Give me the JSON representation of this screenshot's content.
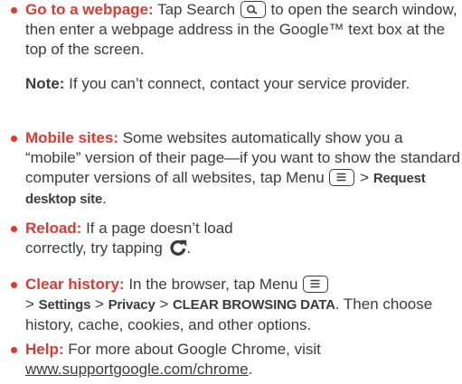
{
  "items": [
    {
      "title": "Go to a webpage:",
      "text_a": " Tap Search ",
      "text_b": " to open the search window, then enter a webpage address in the Google™ text box at the top of the screen."
    },
    {
      "note_label": "Note:",
      "note_text": " If you can’t connect, contact your service provider."
    },
    {
      "title": "Mobile sites:",
      "text_a": " Some websites automatically show you a “mobile” version of their page—if you want to show the standard computer versions of all websites, tap Menu ",
      "text_b": " > ",
      "bold_a": "Request desktop site",
      "text_c": "."
    },
    {
      "title": "Reload:",
      "text_a": " If a page doesn’t load correctly, try tapping ",
      "text_b": "."
    },
    {
      "title": "Clear history:",
      "text_a": " In the browser, tap Menu ",
      "text_b": " > ",
      "bold_a": "Settings",
      "text_c": " > ",
      "bold_b": "Privacy",
      "text_d": " > ",
      "bold_c": "CLEAR BROWSING DATA",
      "text_e": ". Then choose history, cache, cookies, and other options."
    },
    {
      "title": "Help:",
      "text_a": " For more about Google Chrome, visit ",
      "link": "www.supportgoogle.com/chrome",
      "text_b": "."
    }
  ],
  "icons": {
    "search": "search-icon",
    "menu": "menu-icon",
    "reload": "reload-icon"
  },
  "colors": {
    "accent": "#e2392f",
    "text": "#3c3c3c"
  }
}
